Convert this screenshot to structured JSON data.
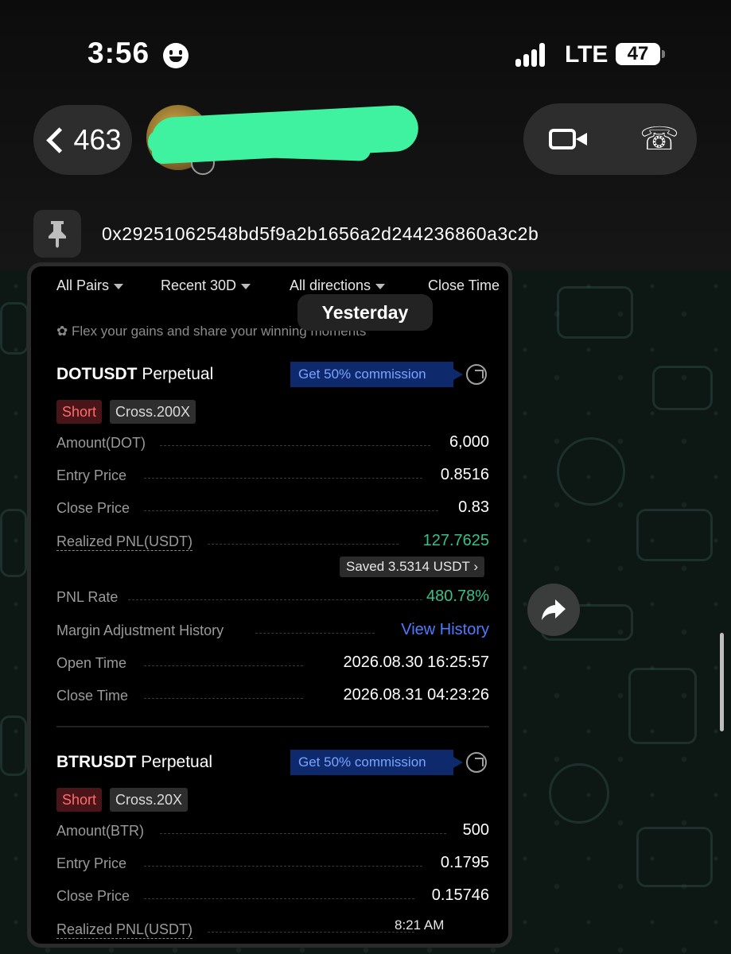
{
  "status_bar": {
    "time": "3:56",
    "network": "LTE",
    "battery": "47"
  },
  "chat_header": {
    "unread_count": "463",
    "contact_name": ""
  },
  "pinned": {
    "text": "0x29251062548bd5f9a2b1656a2d244236860a3c2b"
  },
  "date_divider": "Yesterday",
  "filters": {
    "pairs": "All Pairs",
    "period": "Recent 30D",
    "directions": "All directions",
    "sort": "Close Time"
  },
  "flex_text": "Flex your gains and share your winning moments",
  "trades": [
    {
      "symbol": "DOTUSDT",
      "type": "Perpetual",
      "commission": "Get 50% commission",
      "side": "Short",
      "leverage": "Cross.200X",
      "amount_label": "Amount(DOT)",
      "amount": "6,000",
      "entry_label": "Entry Price",
      "entry": "0.8516",
      "close_label": "Close Price",
      "close": "0.83",
      "pnl_label": "Realized PNL(USDT)",
      "pnl": "127.7625",
      "saved": "Saved 3.5314 USDT",
      "pnl_rate_label": "PNL Rate",
      "pnl_rate": "480.78%",
      "margin_label": "Margin Adjustment History",
      "margin_link": "View History",
      "open_time_label": "Open Time",
      "open_time": "2026.08.30 16:25:57",
      "close_time_label": "Close Time",
      "close_time": "2026.08.31 04:23:26"
    },
    {
      "symbol": "BTRUSDT",
      "type": "Perpetual",
      "commission": "Get 50% commission",
      "side": "Short",
      "leverage": "Cross.20X",
      "amount_label": "Amount(BTR)",
      "amount": "500",
      "entry_label": "Entry Price",
      "entry": "0.1795",
      "close_label": "Close Price",
      "close": "0.15746",
      "pnl_label": "Realized PNL(USDT)"
    }
  ],
  "message_time": "8:21 AM",
  "colors": {
    "profit_green": "#37c08a",
    "short_red": "#ff6b6b",
    "link_blue": "#4d7cff",
    "redaction": "#3ff2a0"
  }
}
